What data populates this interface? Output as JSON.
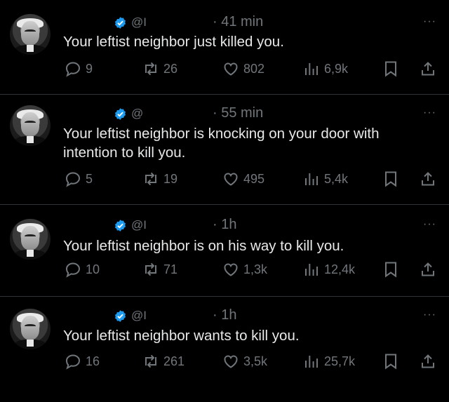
{
  "tweets": [
    {
      "handle": "@I",
      "time": "· 41 min",
      "text": "Your leftist neighbor just killed you.",
      "replies": "9",
      "retweets": "26",
      "likes": "802",
      "views": "6,9k"
    },
    {
      "handle": "@",
      "time": "· 55 min",
      "text": "Your leftist neighbor is knocking on your door with intention to kill you.",
      "replies": "5",
      "retweets": "19",
      "likes": "495",
      "views": "5,4k"
    },
    {
      "handle": "@I",
      "time": "· 1h",
      "text": "Your leftist neighbor is on his way to kill you.",
      "replies": "10",
      "retweets": "71",
      "likes": "1,3k",
      "views": "12,4k"
    },
    {
      "handle": "@I",
      "time": "· 1h",
      "text": "Your leftist neighbor wants to kill you.",
      "replies": "16",
      "retweets": "261",
      "likes": "3,5k",
      "views": "25,7k"
    }
  ],
  "more_label": "···",
  "colors": {
    "background": "#000000",
    "text": "#e7e9ea",
    "muted": "#71767b",
    "verified": "#1d9bf0",
    "divider": "#2f3336"
  },
  "icons": [
    "verified-badge-icon",
    "reply-icon",
    "retweet-icon",
    "like-icon",
    "views-icon",
    "bookmark-icon",
    "share-icon",
    "more-icon"
  ]
}
